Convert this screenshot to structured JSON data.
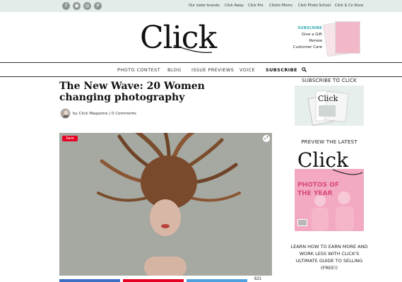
{
  "topbar": {
    "social_icons": [
      "facebook-icon",
      "rss-icon",
      "instagram-icon",
      "pinterest-icon"
    ],
    "sister_label": "Our sister brands:",
    "brands": [
      "Click Away",
      "Click Pro",
      "Clickin Moms",
      "Click Photo School",
      "Click & Co Store"
    ]
  },
  "header": {
    "logo": "Click",
    "promo": {
      "subscribe": "SUBSCRIBE",
      "lines": [
        "Give a Gift",
        "Renew",
        "Customer Care"
      ]
    }
  },
  "nav": {
    "items": [
      "PHOTO CONTEST",
      "BLOG",
      "ISSUE PREVIEWS",
      "VOICE",
      "SUBSCRIBE"
    ],
    "search_icon": "search-icon"
  },
  "article": {
    "title": "The New Wave: 20 Women changing photography",
    "byline": "by Click Magazine | 0 Comments",
    "save_label": "Save",
    "share_count": "621"
  },
  "sidebar": {
    "subscribe_heading": "SUBSCRIBE TO CLICK",
    "preview_heading": "PREVIEW THE LATEST ISSUE",
    "cover_logo": "Click",
    "cover_headline": "PHOTOS OF THE YEAR",
    "promo_text": "LEARN HOW TO EARN MORE AND WORK LESS WITH CLICK'S ULTIMATE GUIDE TO SELLING (FREE!)"
  },
  "colors": {
    "topbar_bg": "#e4ece9",
    "accent_teal": "#3aaeb7",
    "pinterest_red": "#e60023",
    "facebook_blue": "#3b6fc4",
    "twitter_blue": "#4ea1e0",
    "cover_pink": "#f2a9c1"
  }
}
